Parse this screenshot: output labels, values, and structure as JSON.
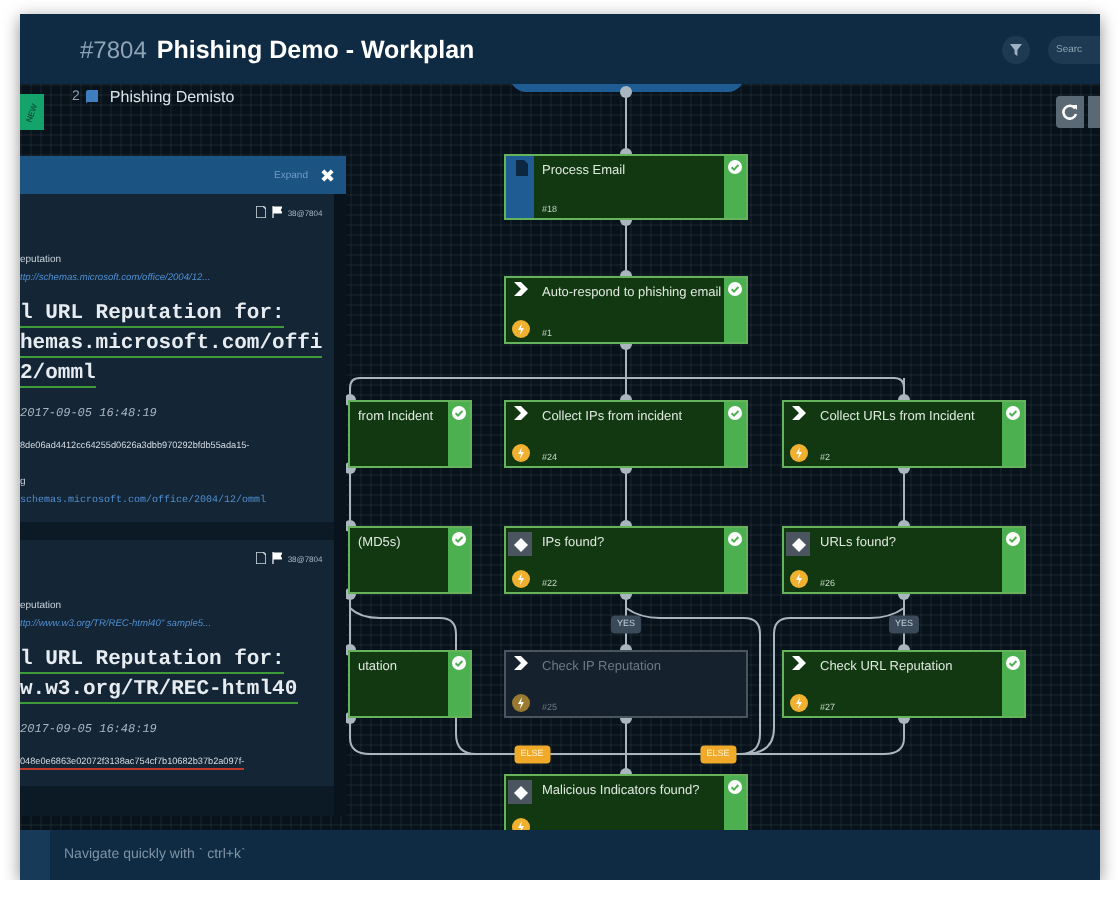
{
  "header": {
    "incident_id": "#7804",
    "title": "Phishing Demo - Workplan",
    "search_placeholder": "Searc"
  },
  "subheader": {
    "ribbon": "NEW",
    "count": "2",
    "name": "Phishing Demisto"
  },
  "workplan": {
    "nodes": [
      {
        "kind": "playbook",
        "title": "Process Email",
        "number": "#18",
        "completed": true
      },
      {
        "kind": "task",
        "title": "Auto-respond to phishing email",
        "number": "#1",
        "completed": true
      },
      {
        "kind": "task-clipped",
        "title": "from Incident",
        "completed": true
      },
      {
        "kind": "task",
        "title": "Collect IPs from incident",
        "number": "#24",
        "completed": true
      },
      {
        "kind": "task",
        "title": "Collect URLs from Incident",
        "number": "#2",
        "completed": true
      },
      {
        "kind": "task-clipped",
        "title": "(MD5s)",
        "completed": true
      },
      {
        "kind": "condition",
        "title": "IPs found?",
        "number": "#22",
        "completed": true
      },
      {
        "kind": "condition",
        "title": "URLs found?",
        "number": "#26",
        "completed": true
      },
      {
        "kind": "task-clipped",
        "title": "utation",
        "completed": true
      },
      {
        "kind": "task",
        "title": "Check IP Reputation",
        "number": "#25",
        "completed": false
      },
      {
        "kind": "task",
        "title": "Check URL Reputation",
        "number": "#27",
        "completed": true
      },
      {
        "kind": "condition",
        "title": "Malicious Indicators found?",
        "completed": true
      }
    ],
    "branch_labels": [
      {
        "kind": "yes",
        "label": "YES"
      },
      {
        "kind": "yes",
        "label": "YES"
      },
      {
        "kind": "else",
        "label": "ELSE"
      },
      {
        "kind": "else",
        "label": "ELSE"
      }
    ]
  },
  "panel": {
    "expand": "Expand",
    "close": "✖",
    "cards": [
      {
        "meta": "38@7804",
        "label": "eputation",
        "link": "ttp://schemas.microsoft.com/office/2004/12...",
        "heading": [
          "l URL Reputation for:",
          "hemas.microsoft.com/offi",
          "2/omml"
        ],
        "date": "2017-09-05 16:48:19",
        "hash": "8de06ad4412cc64255d0626a3dbb970292bfdb55ada15-",
        "flagged": false,
        "extra_label": "g",
        "extra_link": "schemas.microsoft.com/office/2004/12/omml"
      },
      {
        "meta": "38@7804",
        "label": "eputation",
        "link": "ttp://www.w3.org/TR/REC-html40\" sample5...",
        "heading": [
          "l URL Reputation for:",
          "w.w3.org/TR/REC-html40"
        ],
        "date": "2017-09-05 16:48:19",
        "hash": "048e0e6863e02072f3138ac754cf7b10682b37b2a097f-",
        "flagged": true
      }
    ]
  },
  "footer": {
    "placeholder": "Navigate quickly with ` ctrl+k`"
  }
}
